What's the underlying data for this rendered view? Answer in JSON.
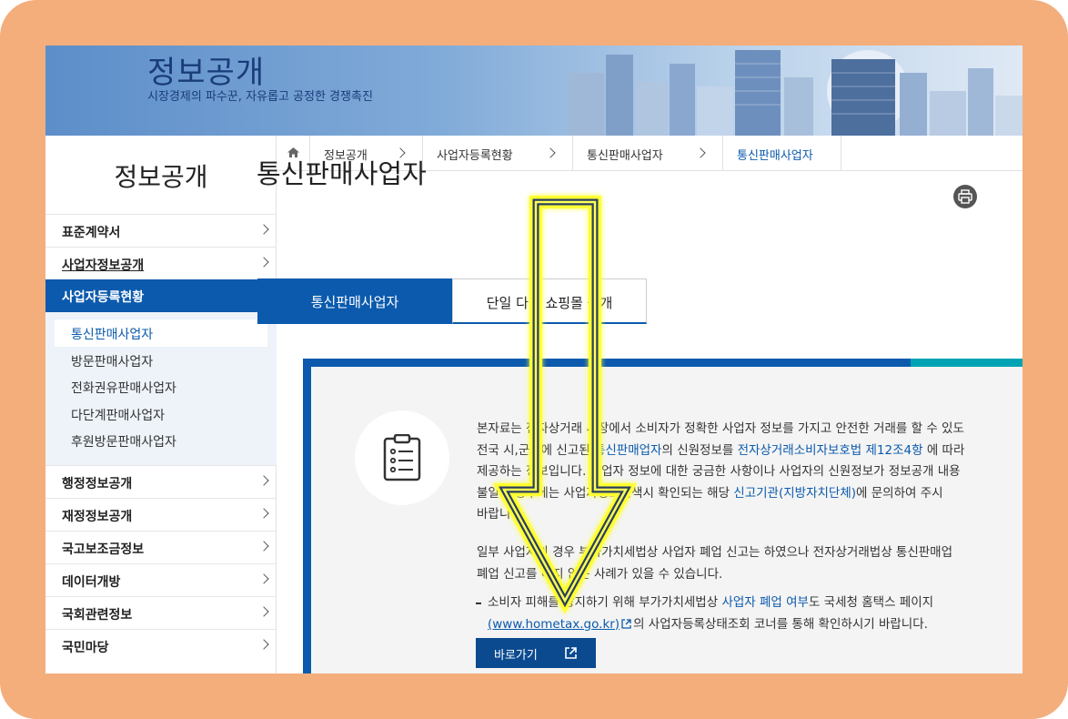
{
  "header": {
    "title": "정보공개",
    "subtitle": "시장경제의 파수꾼, 자유롭고 공정한 경쟁촉진"
  },
  "sidebar": {
    "title": "정보공개",
    "items": [
      {
        "label": "표준계약서"
      },
      {
        "label": "사업자정보공개"
      },
      {
        "label": "사업자등록현황"
      },
      {
        "label": "행정정보공개"
      },
      {
        "label": "재정정보공개"
      },
      {
        "label": "국고보조금정보"
      },
      {
        "label": "데이터개방"
      },
      {
        "label": "국회관련정보"
      },
      {
        "label": "국민마당"
      }
    ],
    "submenu": [
      {
        "label": "통신판매사업자"
      },
      {
        "label": "방문판매사업자"
      },
      {
        "label": "전화권유판매사업자"
      },
      {
        "label": "다단계판매사업자"
      },
      {
        "label": "후원방문판매사업자"
      }
    ]
  },
  "breadcrumb": {
    "items": [
      "정보공개",
      "사업자등록현황",
      "통신판매사업자",
      "통신판매사업자"
    ]
  },
  "main": {
    "title": "통신판매사업자",
    "tabs": [
      {
        "label": "통신판매사업자"
      },
      {
        "label": "단일 다빈 쇼핑몰 공개"
      }
    ],
    "info": {
      "p1_l1": "본자료는 전자상거래 시장에서 소비자가 정확한 사업자 정보를 가지고 안전한 거래를 할 수 있도",
      "p1_l2_a": "전국 시,군구에 신고된 ",
      "p1_l2_link1": "통신판매업자",
      "p1_l2_b": "의 신원정보를 ",
      "p1_l2_link2": "전자상거래소비자보호법 제12조4항",
      "p1_l2_c": " 에 따라",
      "p1_l3": "제공하는 정보입니다. 사업자 정보에 대한 궁금한 사항이나 사업자의 신원정보가 정보공개 내용",
      "p1_l4_a": "불일치 경우에는 사업자정보검색시 확인되는 해당 ",
      "p1_l4_link": "신고기관(지방자치단체)",
      "p1_l4_b": "에 문의하여 주시",
      "p1_l5": "바랍니다.",
      "p2_l1": "일부 사업자의 경우 부가가치세법상 사업자 폐업 신고는 하였으나 전자상거래법상 통신판매업",
      "p2_l2": "폐업 신고를 하지 않은 사례가 있을 수 있습니다.",
      "p3_l1_a": "소비자 피해를 방지하기 위해 부가가치세법상 ",
      "p3_l1_link": "사업자 폐업 여부",
      "p3_l1_b": "도 국세청 홈택스 페이지",
      "p3_l2_link": "(www.hometax.go.kr)",
      "p3_l2_b": "의 사업자등록상태조회 코너를 통해 확인하시기 바랍니다.",
      "go_button": "바로가기"
    }
  },
  "colors": {
    "primary": "#0b5aad",
    "teal": "#00a3b4",
    "frame": "#f3ae7c",
    "annotation_arrow": "#ffff33"
  },
  "icons": [
    "home-icon",
    "print-icon",
    "clipboard-icon",
    "external-link-icon",
    "chevron-right-icon",
    "chevron-up-icon",
    "down-arrow-annotation"
  ]
}
